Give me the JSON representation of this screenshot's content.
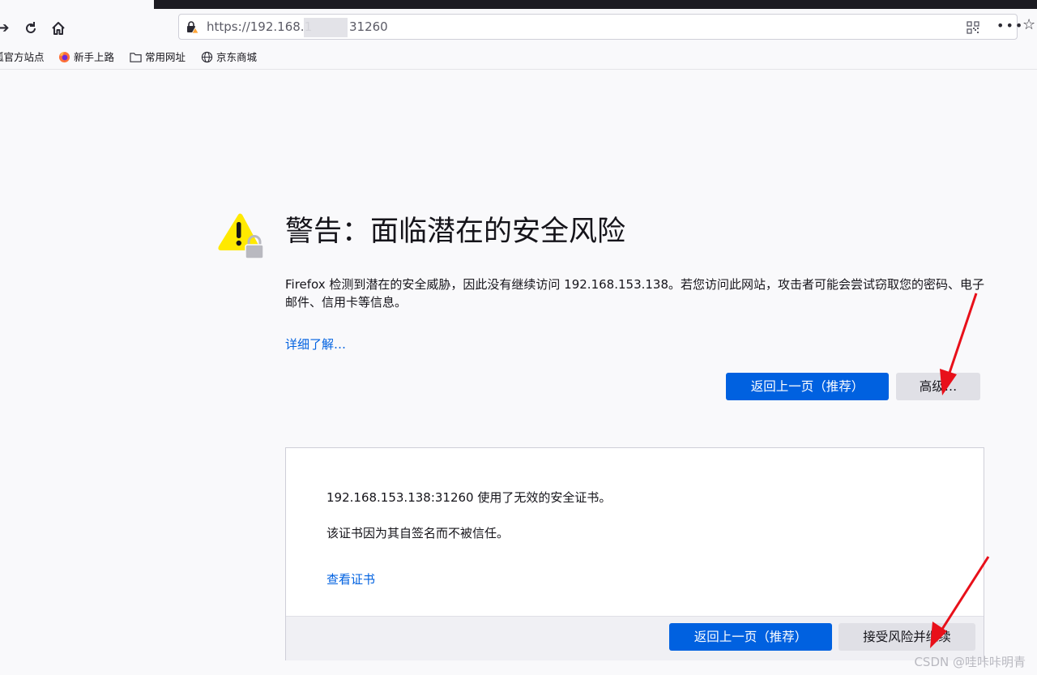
{
  "browser": {
    "url": "https://192.168.1",
    "url_suffix": "31260",
    "bookmarks": [
      {
        "label": "狐官方站点",
        "icon": "firefox-icon"
      },
      {
        "label": "新手上路",
        "icon": "firefox-icon"
      },
      {
        "label": "常用网址",
        "icon": "folder-icon"
      },
      {
        "label": "京东商城",
        "icon": "globe-icon"
      }
    ]
  },
  "warning": {
    "title": "警告：面临潜在的安全风险",
    "description": "Firefox 检测到潜在的安全威胁，因此没有继续访问 192.168.153.138。若您访问此网站，攻击者可能会尝试窃取您的密码、电子邮件、信用卡等信息。",
    "learn_more": "详细了解…",
    "go_back_label": "返回上一页（推荐）",
    "advanced_label": "高级…"
  },
  "advanced": {
    "line1": "192.168.153.138:31260 使用了无效的安全证书。",
    "line2": "该证书因为其自签名而不被信任。",
    "view_cert": "查看证书",
    "go_back_label": "返回上一页（推荐）",
    "accept_label": "接受风险并继续"
  },
  "watermark": "CSDN @哇咔咔明青",
  "colors": {
    "accent": "#0061e0",
    "warning_yellow": "#ffe900",
    "arrow_red": "#e8101a"
  }
}
